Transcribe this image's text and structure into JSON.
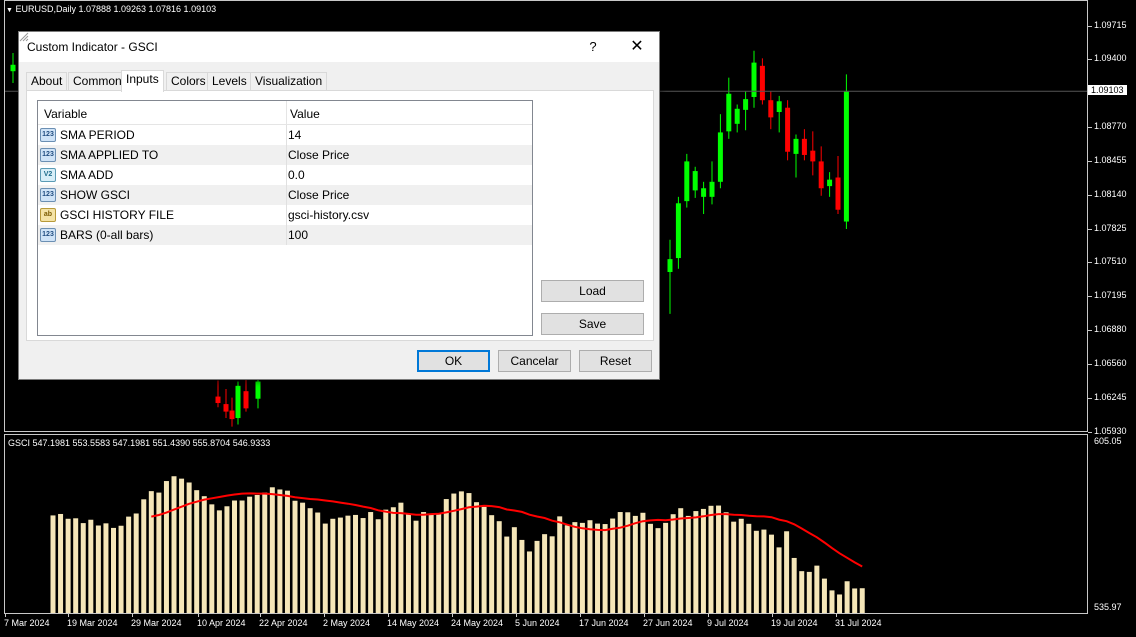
{
  "chart": {
    "header": "EURUSD,Daily  1.07888 1.09263 1.07816 1.09103",
    "current_price": "1.09103",
    "price_axis": [
      "1.09715",
      "1.09400",
      "1.08770",
      "1.08455",
      "1.08140",
      "1.07825",
      "1.07510",
      "1.07195",
      "1.06880",
      "1.06560",
      "1.06245",
      "1.05930"
    ],
    "sub_header": "GSCI 547.1981 553.5583 547.1981 551.4390 555.8704 546.9333",
    "sub_axis": [
      "605.05",
      "535.97"
    ],
    "time_axis": [
      "7 Mar 2024",
      "19 Mar 2024",
      "29 Mar 2024",
      "10 Apr 2024",
      "22 Apr 2024",
      "2 May 2024",
      "14 May 2024",
      "24 May 2024",
      "5 Jun 2024",
      "17 Jun 2024",
      "27 Jun 2024",
      "9 Jul 2024",
      "19 Jul 2024",
      "31 Jul 2024"
    ],
    "colors": {
      "bull": "#00ff00",
      "bear": "#ff0000",
      "histogram": "#f5e6b8",
      "sma": "#ff0000",
      "grid_border": "#c8c8c8"
    }
  },
  "chart_data": [
    {
      "type": "candlestick",
      "title": "EURUSD,Daily",
      "ylim": [
        1.0593,
        1.0986
      ],
      "candles_visible": [
        {
          "o": 1.0929,
          "h": 1.0946,
          "l": 1.0918,
          "c": 1.0935
        },
        {
          "o": 1.0742,
          "h": 1.0772,
          "l": 1.0703,
          "c": 1.0754
        },
        {
          "o": 1.0755,
          "h": 1.0812,
          "l": 1.0745,
          "c": 1.0806
        },
        {
          "o": 1.0808,
          "h": 1.0852,
          "l": 1.0802,
          "c": 1.0845
        },
        {
          "o": 1.0818,
          "h": 1.084,
          "l": 1.0811,
          "c": 1.0836
        },
        {
          "o": 1.0812,
          "h": 1.0826,
          "l": 1.0796,
          "c": 1.082
        },
        {
          "o": 1.0812,
          "h": 1.0845,
          "l": 1.0805,
          "c": 1.0826
        },
        {
          "o": 1.0826,
          "h": 1.0889,
          "l": 1.082,
          "c": 1.0872
        },
        {
          "o": 1.0873,
          "h": 1.0923,
          "l": 1.0866,
          "c": 1.0908
        },
        {
          "o": 1.088,
          "h": 1.0898,
          "l": 1.0872,
          "c": 1.0894
        },
        {
          "o": 1.0893,
          "h": 1.091,
          "l": 1.0874,
          "c": 1.0903
        },
        {
          "o": 1.0905,
          "h": 1.0948,
          "l": 1.0895,
          "c": 1.0937
        },
        {
          "o": 1.0934,
          "h": 1.0941,
          "l": 1.0898,
          "c": 1.0902
        },
        {
          "o": 1.0902,
          "h": 1.091,
          "l": 1.0875,
          "c": 1.0886
        },
        {
          "o": 1.0891,
          "h": 1.0906,
          "l": 1.0872,
          "c": 1.0901
        },
        {
          "o": 1.0895,
          "h": 1.0902,
          "l": 1.0846,
          "c": 1.0854
        },
        {
          "o": 1.0852,
          "h": 1.087,
          "l": 1.083,
          "c": 1.0866
        },
        {
          "o": 1.0866,
          "h": 1.0875,
          "l": 1.0846,
          "c": 1.0851
        },
        {
          "o": 1.0855,
          "h": 1.0873,
          "l": 1.0832,
          "c": 1.0845
        },
        {
          "o": 1.0845,
          "h": 1.0859,
          "l": 1.0813,
          "c": 1.082
        },
        {
          "o": 1.0822,
          "h": 1.0835,
          "l": 1.0812,
          "c": 1.0828
        },
        {
          "o": 1.083,
          "h": 1.085,
          "l": 1.0796,
          "c": 1.08
        },
        {
          "o": 1.0789,
          "h": 1.0926,
          "l": 1.0782,
          "c": 1.091
        }
      ]
    },
    {
      "type": "bar",
      "title": "GSCI",
      "ylim": [
        535.97,
        605.05
      ],
      "histogram_values": [
        574.5,
        575.1,
        573.1,
        573.3,
        571.3,
        572.7,
        570.3,
        571.2,
        569.3,
        570.2,
        574.0,
        575.3,
        581.2,
        584.6,
        584.0,
        588.8,
        590.8,
        589.8,
        588.2,
        585.0,
        582.5,
        579.1,
        576.6,
        578.3,
        580.7,
        580.7,
        582.3,
        583.0,
        584.0,
        586.2,
        585.3,
        584.8,
        580.6,
        579.8,
        577.5,
        575.7,
        571.1,
        573.1,
        573.6,
        574.4,
        574.7,
        573.4,
        575.9,
        572.9,
        576.9,
        577.9,
        579.8,
        575.2,
        572.3,
        575.9,
        574.7,
        575.4,
        581.3,
        583.6,
        584.5,
        583.8,
        580.0,
        578.1,
        574.6,
        572.1,
        565.7,
        569.6,
        564.3,
        559.5,
        563.9,
        566.7,
        565.8,
        574.1,
        570.4,
        571.7,
        571.4,
        572.5,
        571.1,
        570.9,
        573.2,
        575.9,
        575.8,
        574.3,
        575.6,
        571.0,
        569.2,
        571.4,
        575.0,
        577.5,
        574.3,
        576.3,
        577.2,
        578.5,
        578.6,
        575.8,
        571.9,
        573.1,
        571.0,
        568.1,
        568.6,
        566.5,
        561.2,
        567.9,
        556.8,
        551.3,
        551.0,
        553.6,
        548.2,
        543.3,
        541.6,
        547.1,
        544.1,
        544.2
      ]
    }
  ],
  "dialog": {
    "title": "Custom Indicator - GSCI",
    "help_label": "?",
    "close_label": "✕",
    "tabs": [
      "About",
      "Common",
      "Inputs",
      "Colors",
      "Levels",
      "Visualization"
    ],
    "active_tab": "Inputs",
    "grid_headers": {
      "variable": "Variable",
      "value": "Value"
    },
    "params": [
      {
        "icon": "123",
        "name": "SMA PERIOD",
        "value": "14"
      },
      {
        "icon": "123",
        "name": "SMA APPLIED TO",
        "value": "Close Price"
      },
      {
        "icon": "V2",
        "name": "SMA ADD",
        "value": "0.0"
      },
      {
        "icon": "123",
        "name": "SHOW GSCI",
        "value": "Close Price"
      },
      {
        "icon": "ab",
        "name": "GSCI HISTORY FILE",
        "value": "gsci-history.csv"
      },
      {
        "icon": "123",
        "name": "BARS (0-all bars)",
        "value": "100"
      }
    ],
    "buttons": {
      "load": "Load",
      "save": "Save",
      "ok": "OK",
      "cancel": "Cancelar",
      "reset": "Reset"
    }
  }
}
